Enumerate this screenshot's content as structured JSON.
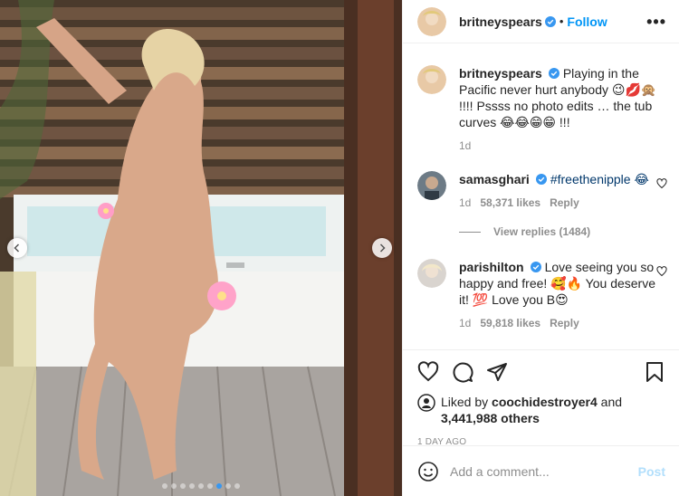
{
  "post": {
    "author": "britneyspears",
    "follow_label": "Follow",
    "separator": "•",
    "more_label": "•••",
    "caption": {
      "username": "britneyspears",
      "text": "Playing in the Pacific never hurt anybody 😉💋🙊 !!!! Pssss no photo edits … the tub curves 😂😂😁😁 !!!",
      "time": "1d"
    },
    "comments": [
      {
        "username": "samasghari",
        "text": "#freethenipple 😂",
        "time": "1d",
        "likes": "58,371 likes",
        "reply_label": "Reply"
      },
      {
        "username": "parishilton",
        "text": "Love seeing you so happy and free! 🥰🔥 You deserve it! 💯 Love you B😍",
        "time": "1d",
        "likes": "59,818 likes",
        "reply_label": "Reply"
      }
    ],
    "view_replies": "View replies (1484)",
    "liked_by_prefix": "Liked by",
    "liked_by_user": "coochidestroyer4",
    "liked_by_and": "and",
    "liked_by_others": "3,441,988 others",
    "timestamp": "1 DAY AGO",
    "add_comment_placeholder": "Add a comment...",
    "post_label": "Post"
  },
  "carousel": {
    "total_slides": 9,
    "active_slide": 7
  },
  "colors": {
    "accent": "#0095f6",
    "post_disabled": "#b2dffc",
    "muted": "#8e8e8e",
    "verified": "#3897f0"
  }
}
